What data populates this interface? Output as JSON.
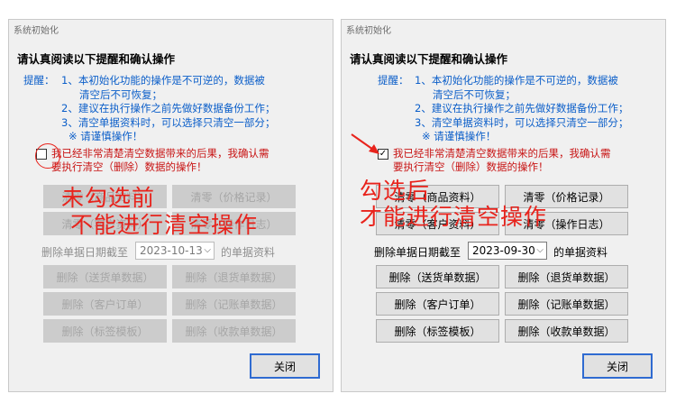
{
  "left": {
    "window_title": "系统初始化",
    "heading": "请认真阅读以下提醒和确认操作",
    "reminder_label": "提醒：",
    "reminder_items": [
      "1、本初始化功能的操作是不可逆的，数据被",
      "清空后不可恢复；",
      "2、建议在执行操作之前先做好数据备份工作；",
      "3、清空单据资料时，可以选择只清空一部分；",
      "※ 请谨慎操作！"
    ],
    "confirm_line1": "我已经非常清楚清空数据带来的后果，我确认需",
    "confirm_line2": "要执行清空（删除）数据的操作！",
    "checkbox_mark": "",
    "buttons": [
      "清零（商品资料）",
      "清零（价格记录）",
      "清零（客户资料）",
      "清零（操作日志）",
      "删除（送货单数据）",
      "删除（退货单数据）",
      "删除（客户订单）",
      "删除（记账单数据）",
      "删除（标签模板）",
      "删除（收款单数据）"
    ],
    "date_label": "删除单据日期截至",
    "date_value": "2023-10-13",
    "date_suffix": "的单据资料",
    "close_label": "关闭",
    "annotation_line1": "未勾选前",
    "annotation_line2": "不能进行清空操作"
  },
  "right": {
    "window_title": "系统初始化",
    "heading": "请认真阅读以下提醒和确认操作",
    "reminder_label": "提醒：",
    "reminder_items": [
      "1、本初始化功能的操作是不可逆的，数据被",
      "清空后不可恢复；",
      "2、建议在执行操作之前先做好数据备份工作；",
      "3、清空单据资料时，可以选择只清空一部分；",
      "※ 请谨慎操作！"
    ],
    "confirm_line1": "我已经非常清楚清空数据带来的后果，我确认需",
    "confirm_line2": "要执行清空（删除）数据的操作！",
    "checkbox_mark": "✓",
    "buttons": [
      "清零（商品资料）",
      "清零（价格记录）",
      "清零（客户资料）",
      "清零（操作日志）",
      "删除（送货单数据）",
      "删除（退货单数据）",
      "删除（客户订单）",
      "删除（记账单数据）",
      "删除（标签模板）",
      "删除（收款单数据）"
    ],
    "date_label": "删除单据日期截至",
    "date_value": "2023-09-30",
    "date_suffix": "的单据资料",
    "close_label": "关闭",
    "annotation_line1": "勾选后",
    "annotation_line2": "才能进行清空操作"
  }
}
